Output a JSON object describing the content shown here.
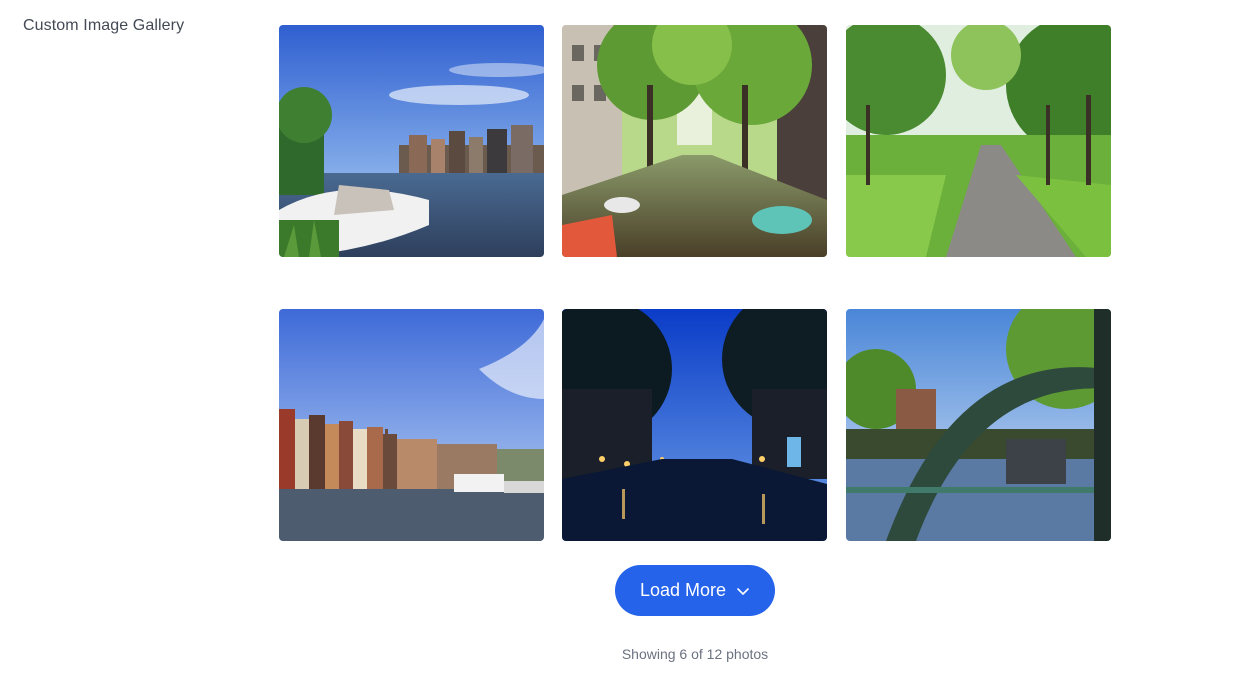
{
  "app": {
    "title": "Custom Image Gallery"
  },
  "gallery": {
    "photos": [
      {
        "scene": "river-with-boats-and-houses"
      },
      {
        "scene": "tree-lined-canal-with-boats"
      },
      {
        "scene": "tree-lined-park-path"
      },
      {
        "scene": "canal-houses-blue-sky"
      },
      {
        "scene": "canal-at-dusk-lights"
      },
      {
        "scene": "green-iron-bridge-over-canal"
      }
    ],
    "load_more_label": "Load More",
    "status_text": "Showing 6 of 12 photos"
  },
  "icons": {
    "load_more": "chevron-down-icon"
  },
  "colors": {
    "accent": "#2563eb",
    "title_text": "#444a55",
    "status_text": "#6b7280"
  }
}
